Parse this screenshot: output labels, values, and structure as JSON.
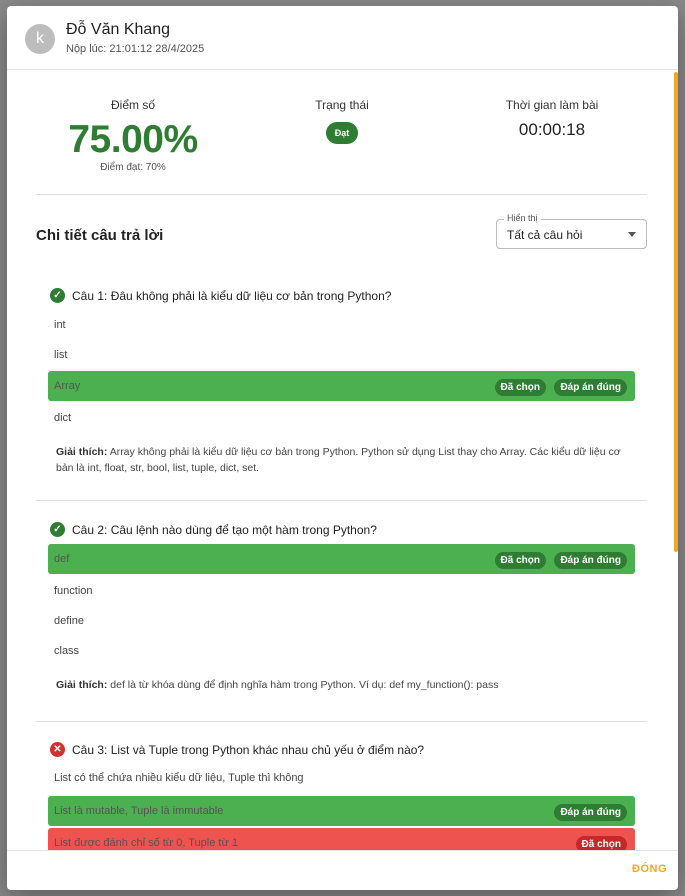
{
  "header": {
    "avatar_letter": "k",
    "student_name": "Đỗ Văn Khang",
    "submitted_at": "Nộp lúc: 21:01:12 28/4/2025"
  },
  "stats": {
    "score_label": "Điểm số",
    "score_value": "75.00%",
    "pass_score": "Điểm đạt: 70%",
    "status_label": "Trạng thái",
    "status_value": "Đạt",
    "time_label": "Thời gian làm bài",
    "time_value": "00:00:18"
  },
  "details": {
    "title": "Chi tiết câu trả lời",
    "filter_label": "Hiển thị",
    "filter_value": "Tất cả câu hỏi"
  },
  "tags": {
    "chosen": "Đã chọn",
    "correct": "Đáp án đúng"
  },
  "explain_prefix": "Giải thích:",
  "questions": [
    {
      "result": "correct",
      "text": "Câu 1: Đâu không phải là kiểu dữ liệu cơ bản trong Python?",
      "options": [
        "int",
        "list",
        "Array",
        "dict"
      ],
      "explanation": "Array không phải là kiểu dữ liệu cơ bản trong Python. Python sử dụng List thay cho Array. Các kiểu dữ liệu cơ bản là int, float, str, bool, list, tuple, dict, set."
    },
    {
      "result": "correct",
      "text": "Câu 2: Câu lệnh nào dùng để tạo một hàm trong Python?",
      "options": [
        "def",
        "function",
        "define",
        "class"
      ],
      "explanation": "def là từ khóa dùng để định nghĩa hàm trong Python. Ví dụ: def my_function(): pass"
    },
    {
      "result": "incorrect",
      "text": "Câu 3: List và Tuple trong Python khác nhau chủ yếu ở điểm nào?",
      "options": [
        "List có thể chứa nhiều kiểu dữ liệu, Tuple thì không",
        "List là mutable, Tuple là immutable",
        "List được đánh chỉ số từ 0, Tuple từ 1"
      ]
    }
  ],
  "footer": {
    "close_label": "ĐÓNG"
  }
}
